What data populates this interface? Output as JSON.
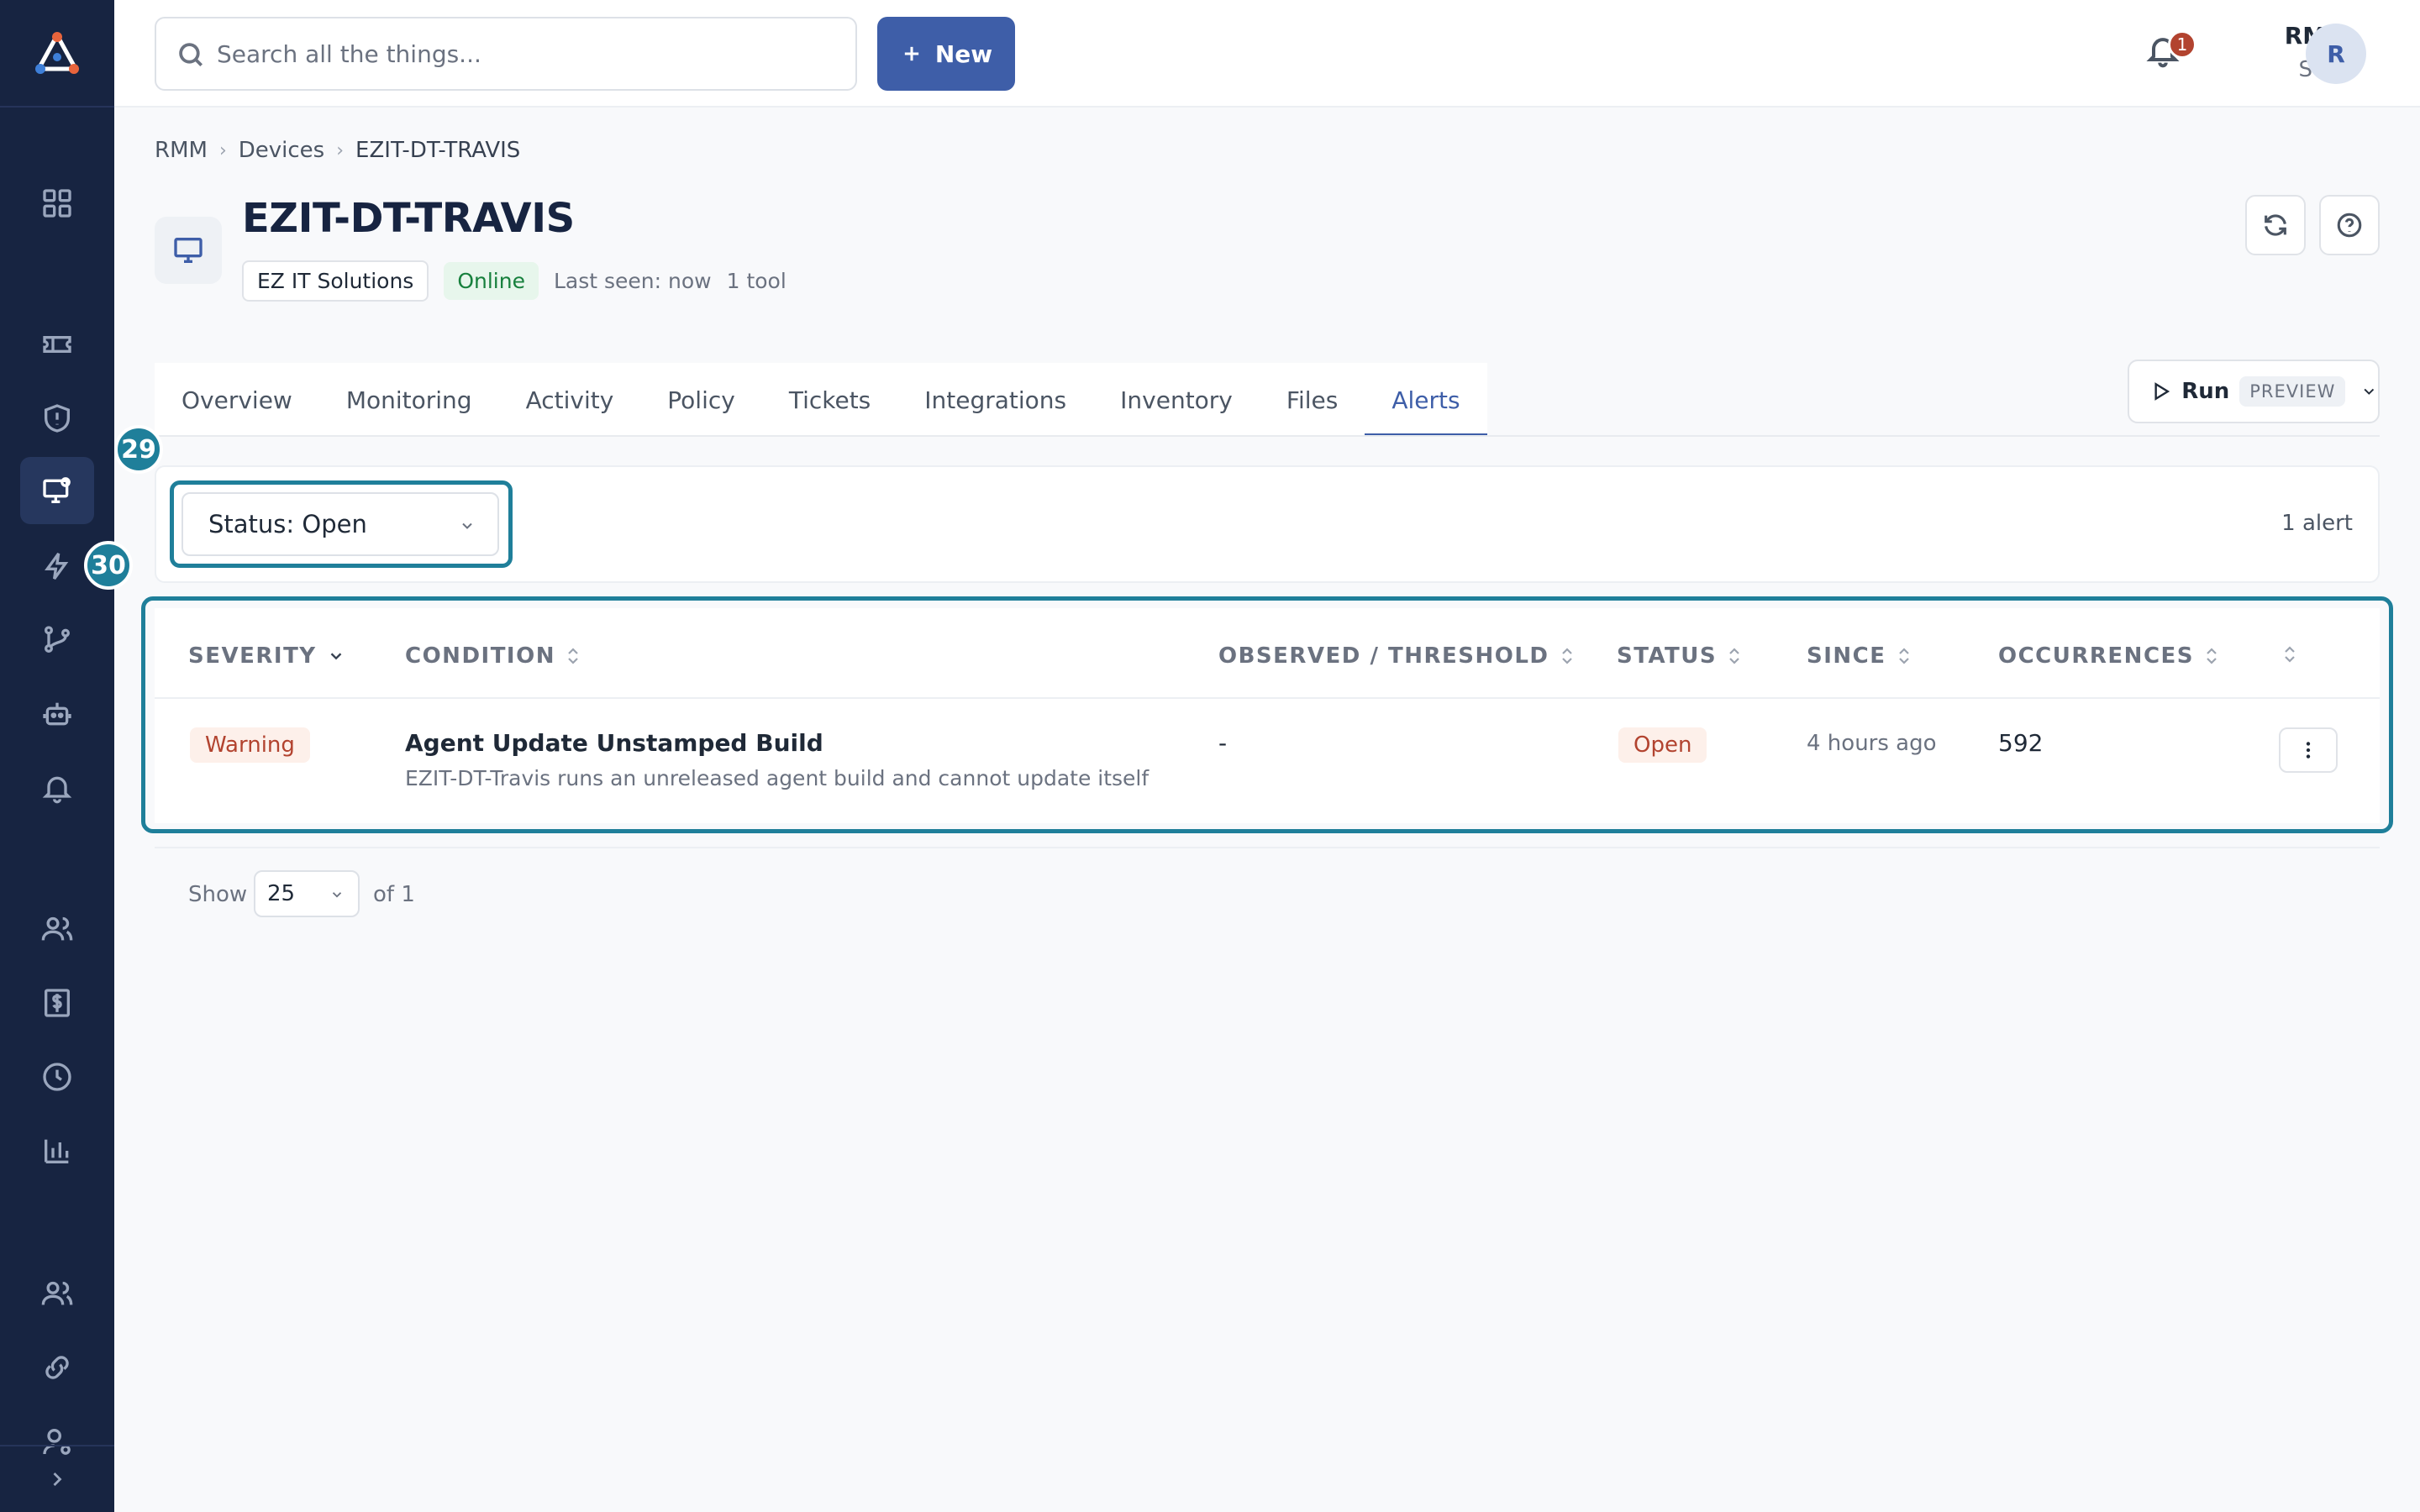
{
  "topbar": {
    "search_placeholder": "Search all the things...",
    "new_label": "New",
    "notification_count": "1",
    "user_name": "RMM",
    "user_role": "Staff",
    "avatar_initial": "R"
  },
  "breadcrumb": [
    "RMM",
    "Devices",
    "EZIT-DT-TRAVIS"
  ],
  "device": {
    "title": "EZIT-DT-TRAVIS",
    "org": "EZ IT Solutions",
    "status": "Online",
    "last_seen": "Last seen: now",
    "tools": "1 tool"
  },
  "tabs": [
    "Overview",
    "Monitoring",
    "Activity",
    "Policy",
    "Tickets",
    "Integrations",
    "Inventory",
    "Files",
    "Alerts"
  ],
  "active_tab": "Alerts",
  "run": {
    "label": "Run",
    "preview": "PREVIEW"
  },
  "filter": {
    "status_select": "Status: Open",
    "count": "1 alert"
  },
  "annotations": {
    "a1": "29",
    "a2": "30"
  },
  "table": {
    "columns": [
      "SEVERITY",
      "CONDITION",
      "OBSERVED / THRESHOLD",
      "STATUS",
      "SINCE",
      "OCCURRENCES"
    ],
    "rows": [
      {
        "severity": "Warning",
        "condition_title": "Agent Update Unstamped Build",
        "condition_desc": "EZIT-DT-Travis runs an unreleased agent build and cannot update itself",
        "observed": "-",
        "status": "Open",
        "since": "4 hours ago",
        "occurrences": "592"
      }
    ]
  },
  "pagination": {
    "show_label": "Show",
    "page_size": "25",
    "of_label": "of 1"
  },
  "colors": {
    "sidebar": "#172441",
    "accent": "#3e5ea8",
    "highlight": "#1f7f9a",
    "warning": "#b2432f",
    "online": "#17803d"
  }
}
